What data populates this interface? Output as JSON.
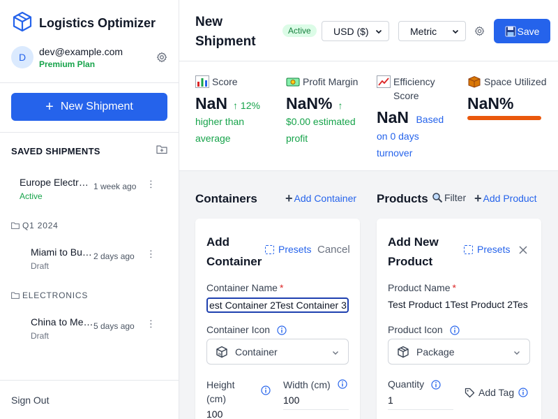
{
  "app": {
    "title": "Logistics Optimizer"
  },
  "user": {
    "avatar_initial": "D",
    "email": "dev@example.com",
    "plan": "Premium Plan"
  },
  "sidebar": {
    "new_shipment_label": "New Shipment",
    "saved_heading": "SAVED SHIPMENTS",
    "shipments": [
      {
        "name": "Europe Electr…",
        "status": "Active",
        "time": "1 week ago"
      },
      {
        "name": "Miami to Bu…",
        "status": "Draft",
        "time": "2 days ago"
      },
      {
        "name": "China to Me…",
        "status": "Draft",
        "time": "5 days ago"
      }
    ],
    "folders": [
      "Q1 2024",
      "ELECTRONICS"
    ],
    "sign_out": "Sign Out"
  },
  "header": {
    "title": "New Shipment",
    "status_badge": "Active",
    "currency": "USD ($)",
    "units": "Metric",
    "save_label": "Save"
  },
  "metrics": {
    "score": {
      "label": "Score",
      "value": "NaN",
      "change": "↑ 12%",
      "note": "higher than average"
    },
    "profit": {
      "label": "Profit Margin",
      "value": "NaN%",
      "arrow": "↑",
      "note": "$0.00 estimated profit"
    },
    "efficiency": {
      "label": "Efficiency Score",
      "value": "NaN",
      "note": "Based on 0 days turnover"
    },
    "space": {
      "label": "Space Utilized",
      "value": "NaN%"
    }
  },
  "containers": {
    "heading": "Containers",
    "add_label": "Add Container",
    "form": {
      "title": "Add Container",
      "presets": "Presets",
      "cancel": "Cancel",
      "name_label": "Container Name",
      "name_value": "est Container 2Test Container 3",
      "icon_label": "Container Icon",
      "icon_value": "Container",
      "height_label": "Height (cm)",
      "height_value": "100",
      "width_label": "Width (cm)",
      "width_value": "100"
    }
  },
  "products": {
    "heading": "Products",
    "filter_label": "Filter",
    "add_label": "Add Product",
    "form": {
      "title": "Add New Product",
      "presets": "Presets",
      "name_label": "Product Name",
      "name_value": "Test Product 1Test Product 2Tes",
      "icon_label": "Product Icon",
      "icon_value": "Package",
      "quantity_label": "Quantity",
      "quantity_value": "1",
      "add_tag": "Add Tag"
    }
  },
  "colors": {
    "primary": "#2563eb",
    "success": "#16a34a",
    "space_bar": "#ea580c"
  }
}
